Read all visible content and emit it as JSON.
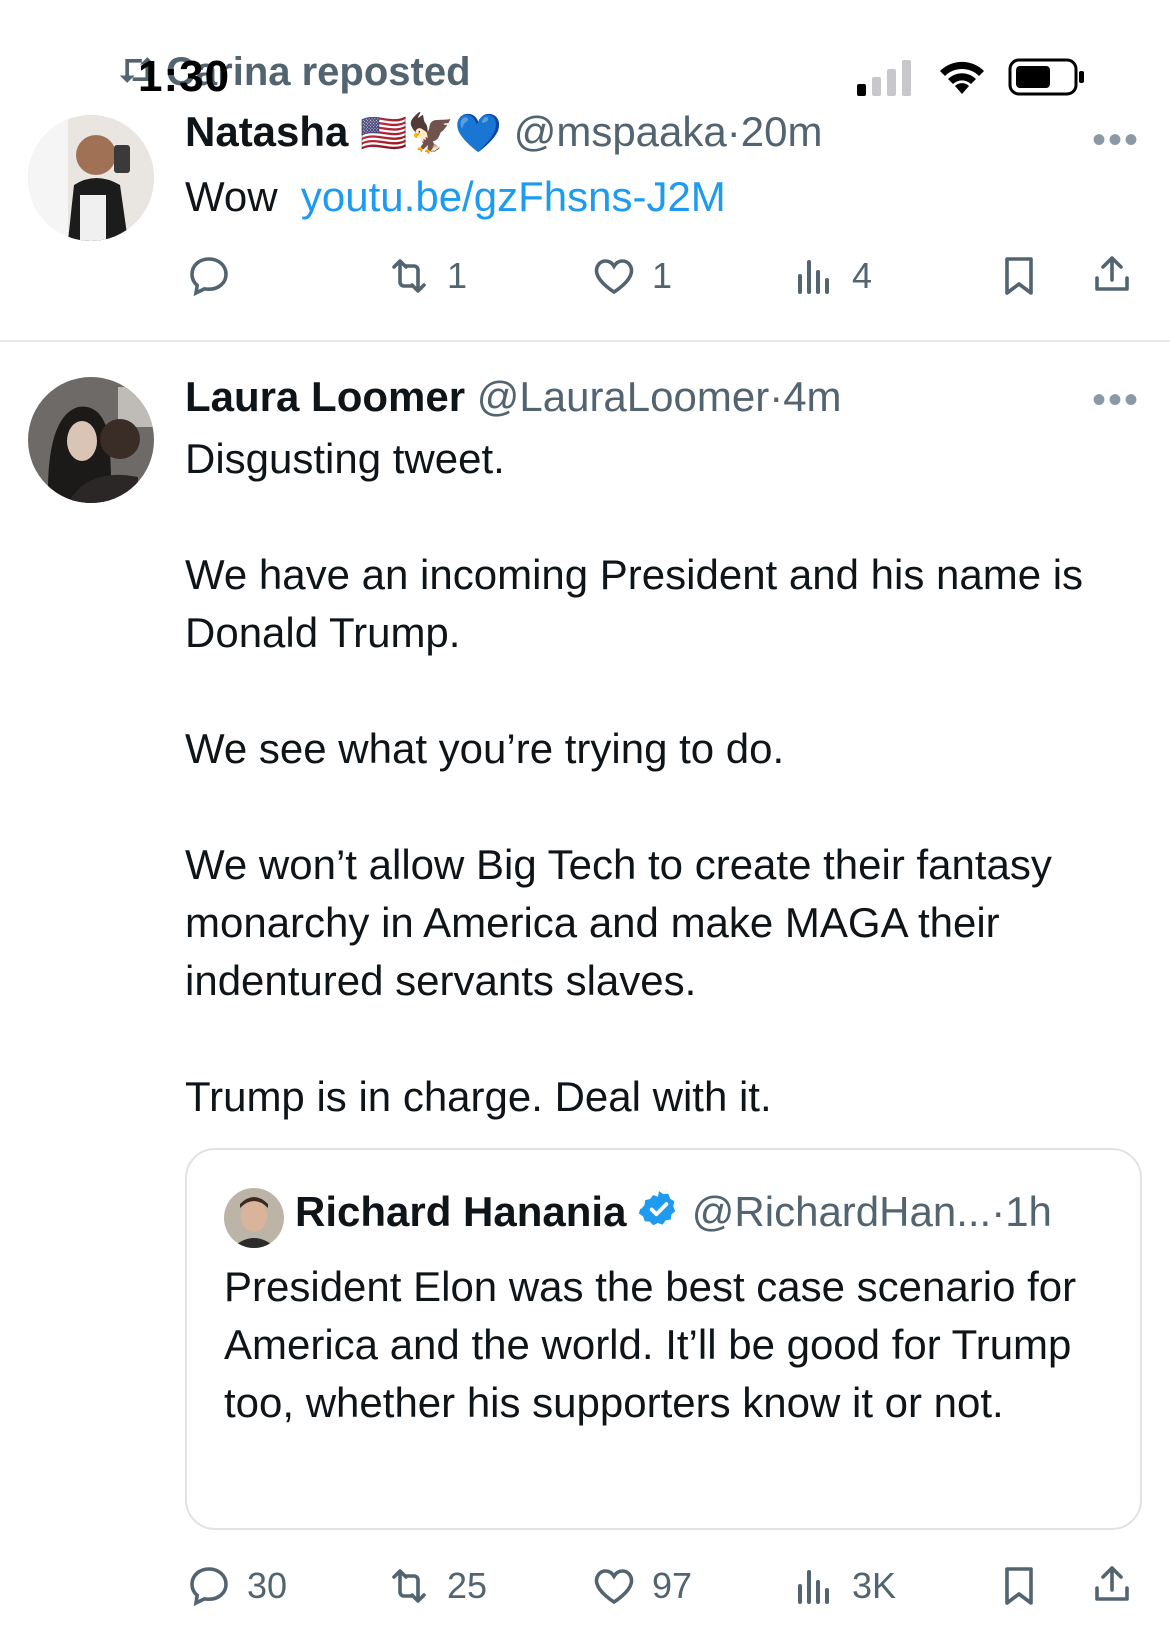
{
  "status_bar": {
    "time": "1:30",
    "repost_label": "Carina reposted"
  },
  "tweet1": {
    "name": "Natasha",
    "emojis": "🇺🇸🦅💙",
    "handle": "@mspaaka",
    "separator": "·",
    "time": "20m",
    "text_prefix": "Wow",
    "link": "youtu.be/gzFhsns-J2M",
    "more": "•••",
    "actions": {
      "replies": "",
      "reposts": "1",
      "likes": "1",
      "views": "4"
    }
  },
  "tweet2": {
    "name": "Laura Loomer",
    "handle": "@LauraLoomer",
    "separator": "·",
    "time": "4m",
    "more": "•••",
    "paragraphs": [
      "Disgusting tweet.",
      "We have an incoming President and his name is Donald Trump.",
      "We see what you’re trying to do.",
      "We won’t allow Big Tech to create their fantasy monarchy in America and make MAGA their indentured servants slaves.",
      "Trump is in charge. Deal with it."
    ],
    "quote": {
      "name": "Richard Hanania",
      "handle": "@RichardHan...",
      "separator": "·",
      "time": "1h",
      "text": "President Elon was the best case scenario for America and the world. It’ll be good for Trump too, whether his supporters know it or not."
    },
    "actions": {
      "replies": "30",
      "reposts": "25",
      "likes": "97",
      "views": "3K"
    }
  },
  "colors": {
    "link": "#1d9bf0",
    "secondary_text": "#536471",
    "verified": "#1d9bf0"
  }
}
